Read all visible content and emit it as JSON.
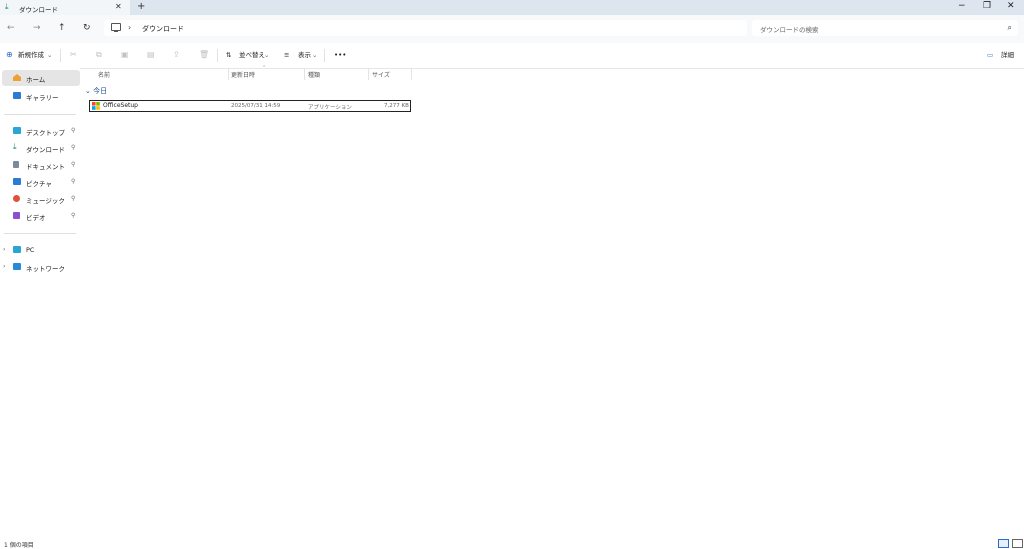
{
  "tab": {
    "title": "ダウンロード",
    "close": "✕",
    "new": "+"
  },
  "window": {
    "minimize": "−",
    "restore": "❐",
    "close": "✕"
  },
  "nav": {
    "back": "←",
    "forward": "→",
    "up": "↑",
    "refresh": "↻"
  },
  "address": {
    "separator": "›",
    "crumb": "ダウンロード"
  },
  "search": {
    "placeholder": "ダウンロードの検索",
    "icon": "⌕"
  },
  "toolbar": {
    "new_label": "新規作成",
    "new_chevron": "⌄",
    "sort_label": "並べ替え",
    "view_label": "表示",
    "more": "•••",
    "details_label": "詳細",
    "icons": [
      "scissors-icon",
      "copy-icon",
      "paste-icon",
      "rename-icon",
      "share-icon",
      "delete-icon"
    ]
  },
  "sidebar": {
    "items": [
      {
        "label": "ホーム",
        "icon": "home-icon",
        "color": "#f0a030"
      },
      {
        "label": "ギャラリー",
        "icon": "gallery-icon",
        "color": "#2a7bd6"
      }
    ],
    "pinned": [
      {
        "label": "デスクトップ",
        "icon": "desktop-icon",
        "color": "#2aa6d6"
      },
      {
        "label": "ダウンロード",
        "icon": "download-icon",
        "color": "#1b8a6b"
      },
      {
        "label": "ドキュメント",
        "icon": "document-icon",
        "color": "#7a8aa0"
      },
      {
        "label": "ピクチャ",
        "icon": "picture-icon",
        "color": "#2a7bd6"
      },
      {
        "label": "ミュージック",
        "icon": "music-icon",
        "color": "#e0503a"
      },
      {
        "label": "ビデオ",
        "icon": "video-icon",
        "color": "#8b4fd1"
      }
    ],
    "tree": [
      {
        "label": "PC",
        "icon": "pc-icon",
        "color": "#2aa6d6"
      },
      {
        "label": "ネットワーク",
        "icon": "network-icon",
        "color": "#2a8ad6"
      }
    ],
    "pin_glyph": "📌",
    "chevron": "›"
  },
  "columns": [
    "名前",
    "更新日時",
    "種類",
    "サイズ"
  ],
  "group": {
    "label": "今日",
    "chevron": "⌄"
  },
  "files": [
    {
      "name": "OfficeSetup",
      "modified": "2025/07/31 14:59",
      "type": "アプリケーション",
      "size": "7,277 KB"
    }
  ],
  "status": {
    "count": "1 個の項目"
  }
}
